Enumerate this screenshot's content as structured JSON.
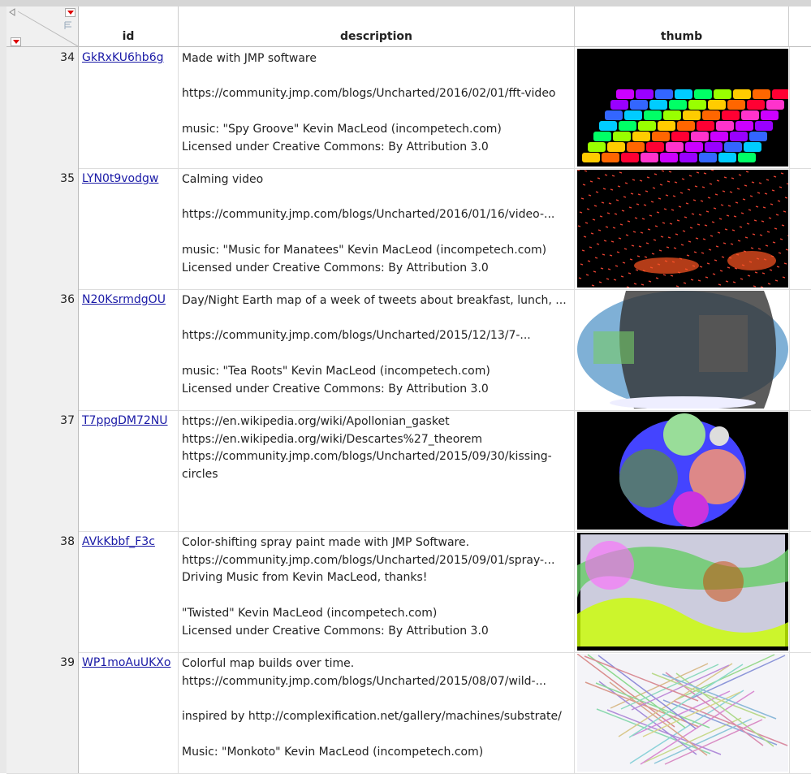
{
  "columns": {
    "id": "id",
    "description": "description",
    "thumb": "thumb"
  },
  "rows": [
    {
      "num": "34",
      "id": "GkRxKU6hb6g",
      "description": "Made with JMP software\n\nhttps://community.jmp.com/blogs/Uncharted/2016/02/01/fft-video\n\nmusic: \"Spy Groove\" Kevin MacLeod (incompetech.com)\nLicensed under Creative Commons: By Attribution 3.0",
      "thumb": "rainbow-blocks"
    },
    {
      "num": "35",
      "id": "LYN0t9vodgw",
      "description": "Calming video\n\nhttps://community.jmp.com/blogs/Uncharted/2016/01/16/video-...\n\nmusic: \"Music for Manatees\" Kevin MacLeod (incompetech.com)\nLicensed under Creative Commons: By Attribution 3.0",
      "thumb": "orange-particles"
    },
    {
      "num": "36",
      "id": "N20KsrmdgOU",
      "description": "Day/Night Earth map of a week of tweets about breakfast, lunch, ...\n\nhttps://community.jmp.com/blogs/Uncharted/2015/12/13/7-...\n\nmusic: \"Tea Roots\" Kevin MacLeod (incompetech.com)\nLicensed under Creative Commons: By Attribution 3.0",
      "thumb": "earth-map"
    },
    {
      "num": "37",
      "id": "T7ppgDM72NU",
      "description": "https://en.wikipedia.org/wiki/Apollonian_gasket\nhttps://en.wikipedia.org/wiki/Descartes%27_theorem\nhttps://community.jmp.com/blogs/Uncharted/2015/09/30/kissing-\ncircles",
      "thumb": "circles"
    },
    {
      "num": "38",
      "id": "AVkKbbf_F3c",
      "description": "Color-shifting spray paint made with JMP Software.\nhttps://community.jmp.com/blogs/Uncharted/2015/09/01/spray-...\nDriving Music from Kevin MacLeod, thanks!\n\n\"Twisted\" Kevin MacLeod (incompetech.com)\nLicensed under Creative Commons: By Attribution 3.0",
      "thumb": "spray-paint"
    },
    {
      "num": "39",
      "id": "WP1moAuUKXo",
      "description": "Colorful map builds over time.\nhttps://community.jmp.com/blogs/Uncharted/2015/08/07/wild-...\n\ninspired by http://complexification.net/gallery/machines/substrate/\n\nMusic: \"Monkoto\" Kevin MacLeod (incompetech.com)",
      "thumb": "substrate"
    }
  ]
}
